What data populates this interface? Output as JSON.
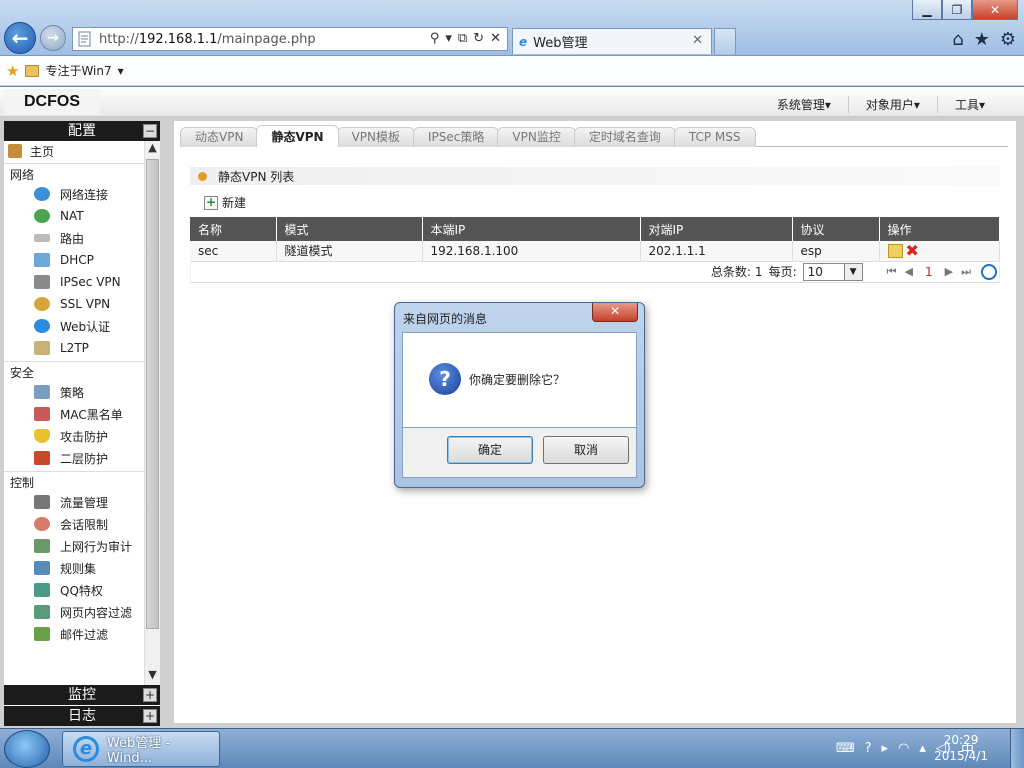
{
  "browser": {
    "url_prefix": "http://",
    "url_host": "192.168.1.1",
    "url_path": "/mainpage.php",
    "tab_title": "Web管理",
    "fav_label": "专注于Win7"
  },
  "app": {
    "logo": "DCFOS",
    "menus": [
      "系统管理",
      "对象用户",
      "工具"
    ]
  },
  "sidebar": {
    "header": "配置",
    "home": "主页",
    "groups": [
      {
        "title": "网络",
        "items": [
          "网络连接",
          "NAT",
          "路由",
          "DHCP",
          "IPSec VPN",
          "SSL VPN",
          "Web认证",
          "L2TP"
        ]
      },
      {
        "title": "安全",
        "items": [
          "策略",
          "MAC黑名单",
          "攻击防护",
          "二层防护"
        ]
      },
      {
        "title": "控制",
        "items": [
          "流量管理",
          "会话限制",
          "上网行为审计",
          "规则集",
          "QQ特权",
          "网页内容过滤",
          "邮件过滤"
        ]
      }
    ],
    "footers": [
      "监控",
      "日志"
    ]
  },
  "tabs": [
    "动态VPN",
    "静态VPN",
    "VPN模板",
    "IPSec策略",
    "VPN监控",
    "定时域名查询",
    "TCP MSS"
  ],
  "list": {
    "title": "静态VPN 列表",
    "new_label": "新建",
    "columns": [
      "名称",
      "模式",
      "本端IP",
      "对端IP",
      "协议",
      "操作"
    ],
    "rows": [
      [
        "sec",
        "隧道模式",
        "192.168.1.100",
        "202.1.1.1",
        "esp"
      ]
    ],
    "pager": {
      "total_label": "总条数:",
      "total": "1",
      "per_page_label": "每页:",
      "per_page": "10",
      "current": "1"
    }
  },
  "dialog": {
    "title": "来自网页的消息",
    "message": "你确定要删除它？",
    "ok": "确定",
    "cancel": "取消"
  },
  "taskbar": {
    "task_label": "Web管理 - Wind...",
    "time": "20:29",
    "date": "2015/4/1"
  }
}
